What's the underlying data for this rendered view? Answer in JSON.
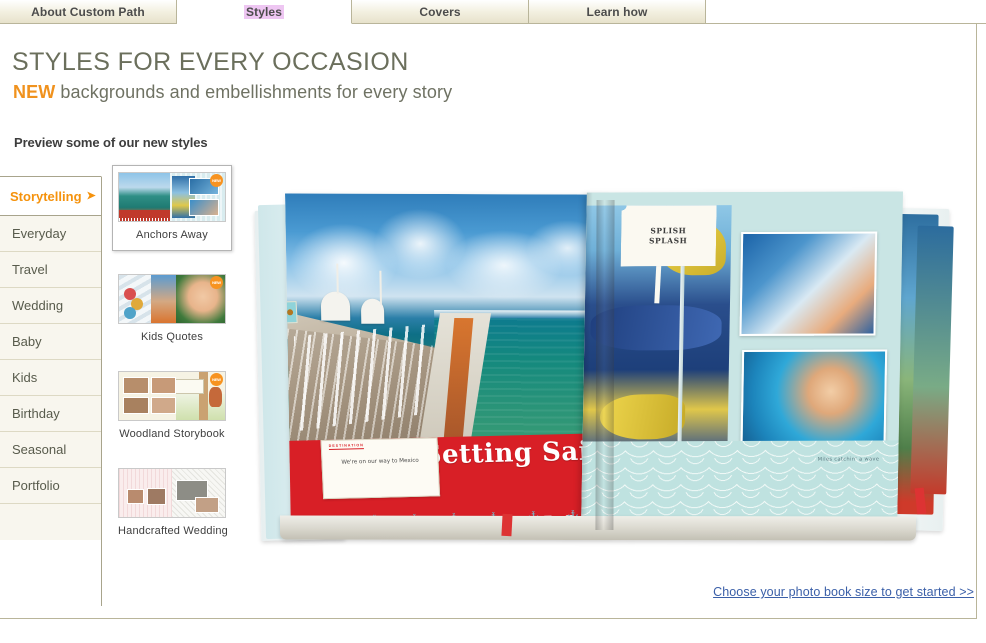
{
  "tabs": [
    {
      "label": "About Custom Path",
      "active": false
    },
    {
      "label": "Styles",
      "active": true
    },
    {
      "label": "Covers",
      "active": false
    },
    {
      "label": "Learn how",
      "active": false
    }
  ],
  "header": {
    "title": "STYLES FOR EVERY OCCASION",
    "subtitle_new": "NEW",
    "subtitle_rest": " backgrounds and embellishments for every story",
    "preview_label": "Preview some of our new styles"
  },
  "sidebar": {
    "items": [
      {
        "label": "Storytelling",
        "active": true,
        "arrow": "➤"
      },
      {
        "label": "Everyday",
        "active": false
      },
      {
        "label": "Travel",
        "active": false
      },
      {
        "label": "Wedding",
        "active": false
      },
      {
        "label": "Baby",
        "active": false
      },
      {
        "label": "Kids",
        "active": false
      },
      {
        "label": "Birthday",
        "active": false
      },
      {
        "label": "Seasonal",
        "active": false
      },
      {
        "label": "Portfolio",
        "active": false
      }
    ]
  },
  "thumbnails": [
    {
      "caption": "Anchors Away",
      "selected": true,
      "badge": "NEW"
    },
    {
      "caption": "Kids Quotes",
      "selected": false,
      "badge": "NEW"
    },
    {
      "caption": "Woodland Storybook",
      "selected": false,
      "badge": "NEW"
    },
    {
      "caption": "Handcrafted Wedding",
      "selected": false,
      "badge": ""
    }
  ],
  "preview": {
    "left_page": {
      "banner_title": "Setting Sail",
      "tag_heading": "DESTINATION",
      "tag_text": "We're on our way to Mexico",
      "anchors": "⚓ ⚓ ⚓ ⚓ ⚓ ⚓ ⚓ ⚓ ⚓ ⚓ ⚓ ⚓ ⚓ ⚓"
    },
    "right_page": {
      "label_line1": "SPLISH",
      "label_line2": "SPLASH",
      "caption": "Miles catchin' a wave"
    }
  },
  "footer": {
    "cta": "Choose your photo book size to get started >>"
  },
  "colors": {
    "accent_orange": "#f5920c",
    "tab_active_highlight": "#eec6f2",
    "link_blue": "#3a5fa8",
    "heading_olive": "#6b6f5c",
    "sidebar_bg": "#f8f6ee",
    "border_sage": "#b9b59a",
    "banner_red": "#d81f26"
  }
}
